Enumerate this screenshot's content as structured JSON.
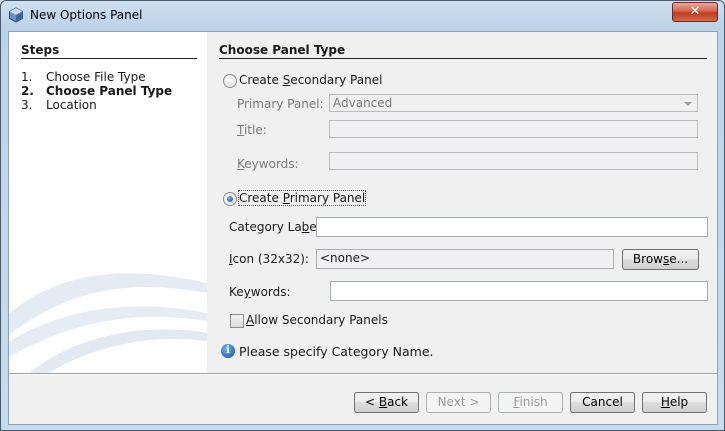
{
  "window": {
    "title": "New Options Panel",
    "close_label": "✕"
  },
  "steps": {
    "header": "Steps",
    "items": [
      {
        "num": "1.",
        "label": "Choose File Type"
      },
      {
        "num": "2.",
        "label": "Choose Panel Type"
      },
      {
        "num": "3.",
        "label": "Location"
      }
    ]
  },
  "panel": {
    "header": "Choose Panel Type",
    "secondary": {
      "radio_pre": "Create ",
      "radio_mn": "S",
      "radio_post": "econdary Panel",
      "primary_panel_label": "Primary Panel:",
      "primary_panel_value": "Advanced",
      "title_mn": "T",
      "title_post": "itle:",
      "title_value": "",
      "keywords_mn": "K",
      "keywords_post": "eywords:",
      "keywords_value": ""
    },
    "primary": {
      "radio_pre": "Create ",
      "radio_mn": "P",
      "radio_post": "rimary Panel",
      "category_pre": "Category La",
      "category_mn": "b",
      "category_post": "el:",
      "category_value": "",
      "icon_mn": "I",
      "icon_post": "con (32x32):",
      "icon_value": "<none>",
      "browse_pre": "Brow",
      "browse_mn": "s",
      "browse_post": "e...",
      "keywords_pre": "Ke",
      "keywords_mn": "y",
      "keywords_post": "words:",
      "keywords_value": "",
      "allow_mn": "A",
      "allow_post": "llow Secondary Panels"
    },
    "message": "Please specify Category Name."
  },
  "buttons": {
    "back_pre": "< ",
    "back_mn": "B",
    "back_post": "ack",
    "next": "Next >",
    "finish_mn": "F",
    "finish_post": "inish",
    "cancel": "Cancel",
    "help_mn": "H",
    "help_post": "elp"
  }
}
